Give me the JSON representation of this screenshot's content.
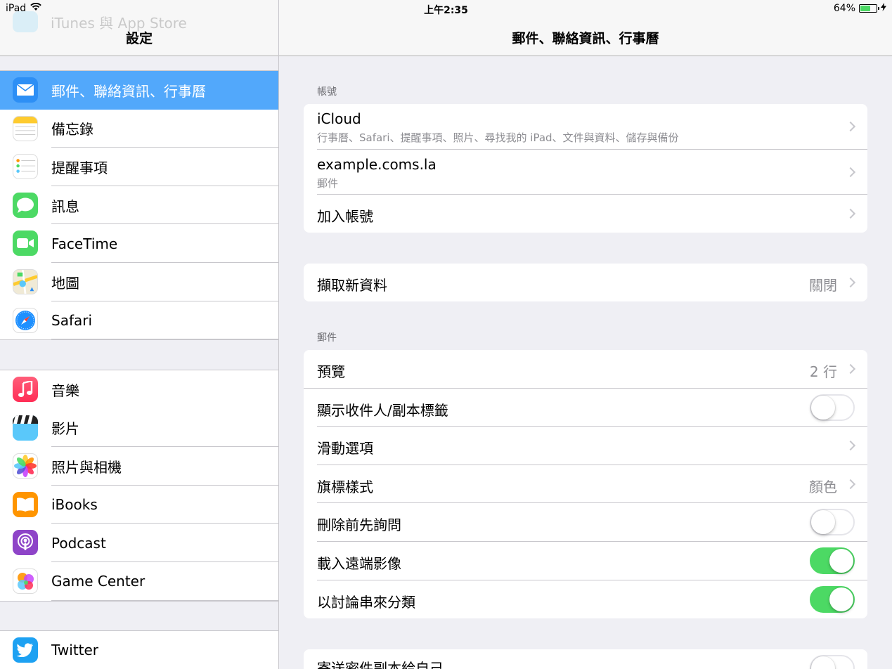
{
  "status": {
    "device": "iPad",
    "time": "上午2:35",
    "battery_text": "64%",
    "battery_level": 0.64
  },
  "sidebar": {
    "ghost_item": "iTunes 與 App Store",
    "title": "設定",
    "groups": [
      [
        {
          "label": "郵件、聯絡資訊、行事曆",
          "icon": "mail-icon",
          "selected": true
        },
        {
          "label": "備忘錄",
          "icon": "notes-icon"
        },
        {
          "label": "提醒事項",
          "icon": "reminders-icon"
        },
        {
          "label": "訊息",
          "icon": "messages-icon"
        },
        {
          "label": "FaceTime",
          "icon": "facetime-icon"
        },
        {
          "label": "地圖",
          "icon": "maps-icon"
        },
        {
          "label": "Safari",
          "icon": "safari-icon"
        }
      ],
      [
        {
          "label": "音樂",
          "icon": "music-icon"
        },
        {
          "label": "影片",
          "icon": "videos-icon"
        },
        {
          "label": "照片與相機",
          "icon": "photos-icon"
        },
        {
          "label": "iBooks",
          "icon": "ibooks-icon"
        },
        {
          "label": "Podcast",
          "icon": "podcast-icon"
        },
        {
          "label": "Game Center",
          "icon": "game-center-icon"
        }
      ],
      [
        {
          "label": "Twitter",
          "icon": "twitter-icon"
        }
      ]
    ]
  },
  "main": {
    "title": "郵件、聯絡資訊、行事曆",
    "accounts_header": "帳號",
    "accounts": [
      {
        "title": "iCloud",
        "sub": "行事曆、Safari、提醒事項、照片、尋找我的 iPad、文件與資料、儲存與備份"
      },
      {
        "title": "example.coms.la",
        "sub": "郵件"
      },
      {
        "title": "加入帳號"
      }
    ],
    "fetch": {
      "title": "擷取新資料",
      "value": "關閉"
    },
    "mail_header": "郵件",
    "mail_rows": [
      {
        "title": "預覽",
        "value": "2 行",
        "type": "chevron"
      },
      {
        "title": "顯示收件人/副本標籤",
        "type": "toggle",
        "on": false
      },
      {
        "title": "滑動選項",
        "type": "chevron"
      },
      {
        "title": "旗標樣式",
        "value": "顏色",
        "type": "chevron"
      },
      {
        "title": "刪除前先詢問",
        "type": "toggle",
        "on": false
      },
      {
        "title": "載入遠端影像",
        "type": "toggle",
        "on": true
      },
      {
        "title": "以討論串來分類",
        "type": "toggle",
        "on": true
      }
    ],
    "bottom_row": {
      "title": "寄送密件副本給自己",
      "on": false
    }
  },
  "colors": {
    "accent": "#52a8fb",
    "toggle_on": "#4cd964",
    "background": "#efeff4"
  }
}
